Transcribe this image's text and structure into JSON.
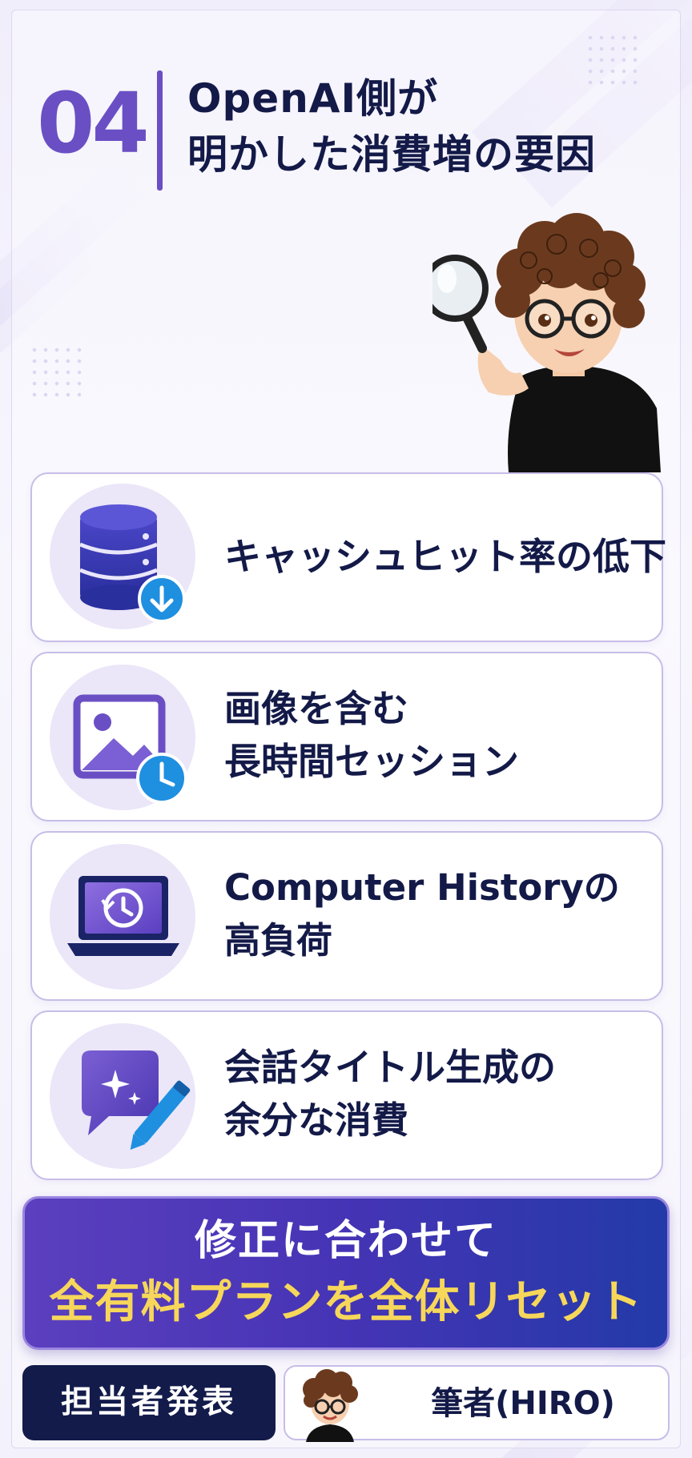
{
  "header": {
    "number": "04",
    "title_line1": "OpenAI側が",
    "title_line2": "明かした消費増の要因"
  },
  "factors": [
    {
      "icon": "database-download-icon",
      "line1": "キャッシュヒット率の低下",
      "line2": ""
    },
    {
      "icon": "image-clock-icon",
      "line1": "画像を含む",
      "line2": "長時間セッション"
    },
    {
      "icon": "laptop-history-icon",
      "line1": "Computer Historyの",
      "line2": "高負荷"
    },
    {
      "icon": "chat-sparkle-pencil-icon",
      "line1": "会話タイトル生成の",
      "line2": "余分な消費"
    }
  ],
  "banner": {
    "line1": "修正に合わせて",
    "line2": "全有料プランを全体リセット"
  },
  "footer": {
    "announcer_label": "担当者発表",
    "author_label": "筆者(HIRO)"
  },
  "colors": {
    "accent": "#6a4fc4",
    "navy": "#131a48",
    "banner_highlight": "#f6d75a",
    "icon_badge_blue": "#1f8fe0"
  }
}
